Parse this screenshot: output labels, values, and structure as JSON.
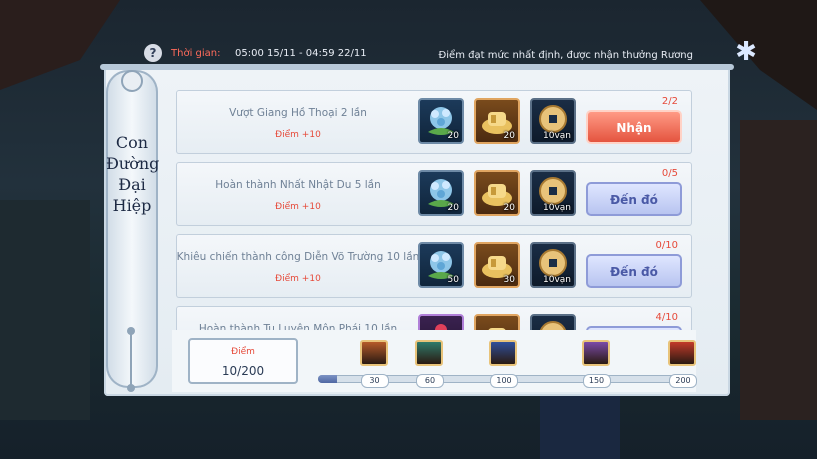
{
  "header": {
    "help_icon": "question-icon",
    "time_label": "Thời gian:",
    "time_range": "05:00 15/11 - 04:59 22/11",
    "hint": "Điểm đạt mức nhất định, được nhận thưởng Rương",
    "close_icon": "close-icon"
  },
  "scroll": {
    "title_lines": [
      "Con",
      "Đường",
      "Đại",
      "Hiệp"
    ]
  },
  "tasks": [
    {
      "title": "Vượt Giang Hồ Thoại 2 lần",
      "points": "Điểm +10",
      "rewards": [
        {
          "icon": "flower-icon",
          "count": "20"
        },
        {
          "icon": "gold-ingot-icon",
          "count": "20"
        },
        {
          "icon": "coin-icon",
          "count": "10vạn"
        }
      ],
      "progress": "2/2",
      "button": "Nhận",
      "button_type": "claim"
    },
    {
      "title": "Hoàn thành Nhất Nhật Du 5 lần",
      "points": "Điểm +10",
      "rewards": [
        {
          "icon": "flower-icon",
          "count": "20"
        },
        {
          "icon": "gold-ingot-icon",
          "count": "20"
        },
        {
          "icon": "coin-icon",
          "count": "10vạn"
        }
      ],
      "progress": "0/5",
      "button": "Đến đó",
      "button_type": "go"
    },
    {
      "title": "Khiêu chiến thành công Diễn Võ Trường 10 lần",
      "points": "Điểm +10",
      "rewards": [
        {
          "icon": "flower-icon",
          "count": "50"
        },
        {
          "icon": "gold-ingot-icon",
          "count": "30"
        },
        {
          "icon": "coin-icon",
          "count": "10vạn"
        }
      ],
      "progress": "0/10",
      "button": "Đến đó",
      "button_type": "go"
    },
    {
      "title": "Hoàn thành Tu Luyện Môn Phái 10 lần",
      "points": "",
      "rewards": [
        {
          "icon": "purple-item-icon",
          "count": ""
        },
        {
          "icon": "gold-ingot-icon",
          "count": ""
        },
        {
          "icon": "coin-icon",
          "count": ""
        }
      ],
      "progress": "4/10",
      "button": "",
      "button_type": "go"
    }
  ],
  "score": {
    "label": "Điểm",
    "value": "10/200",
    "current": 10,
    "max": 200
  },
  "milestones": [
    {
      "value": 30,
      "label": "30",
      "chest": "chest-brown-icon",
      "color": "#b55a2a"
    },
    {
      "value": 60,
      "label": "60",
      "chest": "chest-green-icon",
      "color": "#2f7a6a"
    },
    {
      "value": 100,
      "label": "100",
      "chest": "chest-blue-icon",
      "color": "#2f4f9a"
    },
    {
      "value": 150,
      "label": "150",
      "chest": "chest-purple-icon",
      "color": "#7a4aa8"
    },
    {
      "value": 200,
      "label": "200",
      "chest": "chest-red-icon",
      "color": "#c23a2a"
    }
  ],
  "colors": {
    "accent_red": "#e64a3a",
    "claim_button": "#e4543f",
    "go_button": "#b8c4f0"
  }
}
